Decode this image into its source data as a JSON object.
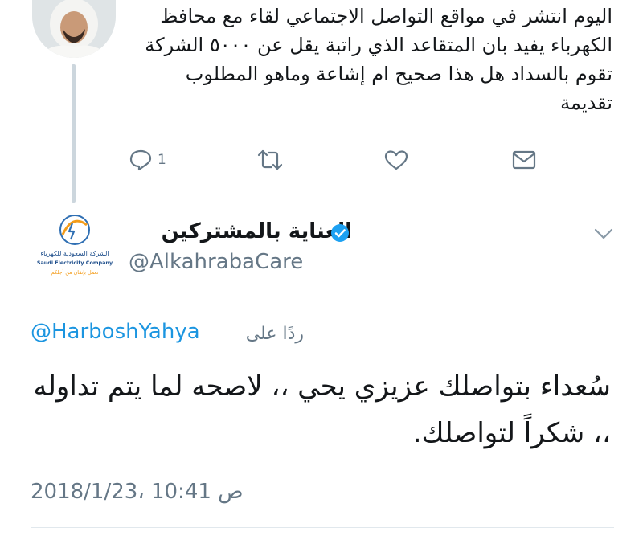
{
  "parent_tweet": {
    "text": "اليوم انتشر في مواقع التواصل الاجتماعي لقاء مع محافظ الكهرباء يفيد بان المتقاعد الذي راتبة يقل عن ٥٠٠٠ الشركة تقوم بالسداد  هل هذا صحيح ام إشاعة وماهو المطلوب تقديمة",
    "reply_count": "1",
    "icons": [
      "reply-icon",
      "retweet-icon",
      "like-icon",
      "direct-message-icon"
    ]
  },
  "main_tweet": {
    "display_name": "العناية بالمشتركين",
    "username": "@AlkahrabaCare",
    "logo": {
      "arabic_name": "الشركة السعودية للكهرباء",
      "english_name": "Saudi Electricity Company",
      "tagline": "نعمل بإتقان من أجلكم"
    },
    "replying_to_label": "ردًا على",
    "replying_to_handle": "@HarboshYahya",
    "text": "سُعداء بتواصلك عزيزي يحي ،، لاصحه لما يتم تداوله ،، شكراً لتواصلك.",
    "timestamp": "2018/1/23، 10:41 ص"
  },
  "colors": {
    "link": "#1b95e0",
    "secondary_text": "#657786",
    "verified": "#1da1f2",
    "divider": "#e1e8ed"
  }
}
